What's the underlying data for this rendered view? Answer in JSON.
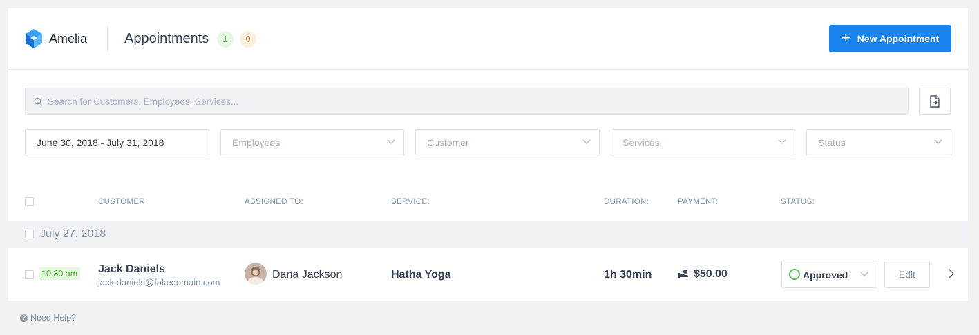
{
  "header": {
    "brand": "Amelia",
    "title": "Appointments",
    "badge_approved_count": "1",
    "badge_pending_count": "0",
    "new_button_label": "New Appointment"
  },
  "search": {
    "placeholder": "Search for Customers, Employees, Services..."
  },
  "filters": {
    "date_range": "June 30, 2018 - July 31, 2018",
    "employees_placeholder": "Employees",
    "customer_placeholder": "Customer",
    "services_placeholder": "Services",
    "status_placeholder": "Status"
  },
  "table": {
    "columns": [
      "CUSTOMER:",
      "ASSIGNED TO:",
      "SERVICE:",
      "DURATION:",
      "PAYMENT:",
      "STATUS:"
    ],
    "groups": [
      {
        "date": "July 27, 2018",
        "rows": [
          {
            "time": "10:30 am",
            "customer_name": "Jack Daniels",
            "customer_email": "jack.daniels@fakedomain.com",
            "employee_name": "Dana Jackson",
            "service": "Hatha Yoga",
            "duration": "1h 30min",
            "price": "$50.00",
            "status": "Approved",
            "edit_label": "Edit"
          }
        ]
      }
    ]
  },
  "footer": {
    "help_label": "Need Help?"
  },
  "colors": {
    "accent": "#1a84ee",
    "approved": "#5cb85c",
    "pending": "#f0a13c"
  },
  "icons": {
    "logo": "amelia-cube-icon",
    "search": "search-icon",
    "export": "export-icon",
    "dropdown": "chevron-down-icon",
    "payment": "cash-icon",
    "expand": "chevron-right-icon",
    "help": "question-icon"
  }
}
